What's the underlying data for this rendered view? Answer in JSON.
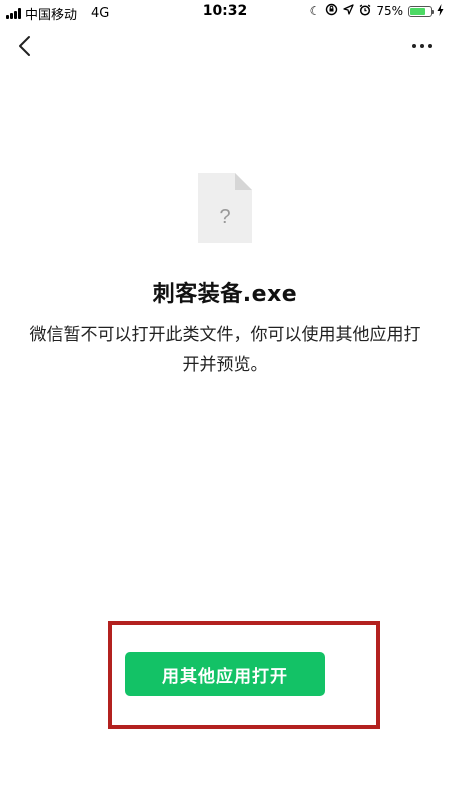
{
  "status_bar": {
    "carrier": "中国移动",
    "network": "4G",
    "time": "10:32",
    "battery_percent": "75%",
    "battery_level": 0.75,
    "icons": [
      "signal-icon",
      "moon-icon",
      "orientation-lock-icon",
      "location-icon",
      "alarm-icon",
      "battery-icon",
      "charging-icon"
    ]
  },
  "nav": {
    "back_icon": "chevron-left-icon",
    "more_icon": "more-dots-icon"
  },
  "file": {
    "icon": "unknown-file-icon",
    "icon_glyph": "?",
    "name": "刺客装备.exe",
    "message": "微信暂不可以打开此类文件，你可以使用其他应用打开并预览。"
  },
  "actions": {
    "open_with_other_app_label": "用其他应用打开"
  },
  "colors": {
    "button_green": "#13c266",
    "highlight_red": "#b3211f",
    "battery_green": "#4cd964"
  }
}
